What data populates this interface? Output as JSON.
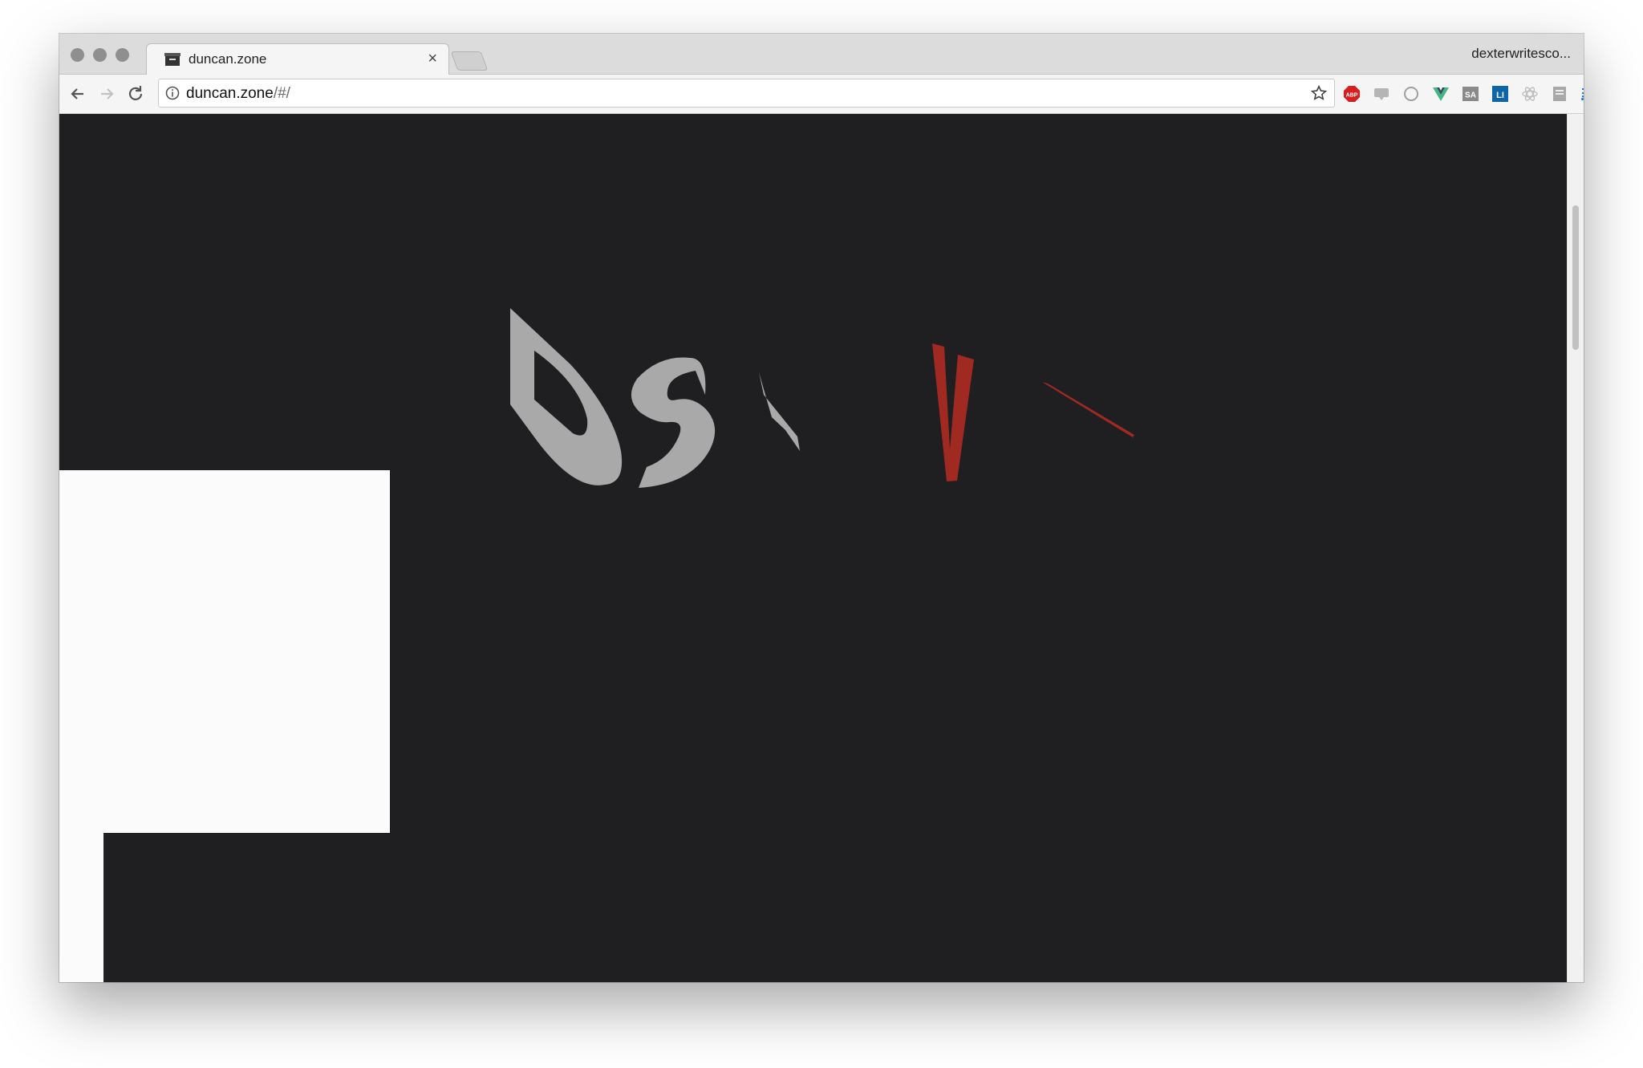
{
  "browser": {
    "tab": {
      "title": "duncan.zone"
    },
    "profile_name": "dexterwritesco...",
    "address": {
      "host": "duncan.zone",
      "path": "/#/"
    },
    "extensions": [
      {
        "name": "adblock-plus",
        "label": "ABP",
        "color": "#d81f1f"
      },
      {
        "name": "chat-extension",
        "label": "",
        "color": "#9e9e9e"
      },
      {
        "name": "circle-extension",
        "label": "",
        "color": "#9e9e9e"
      },
      {
        "name": "vue-devtools",
        "label": "V",
        "color": "#41b883"
      },
      {
        "name": "sa-extension",
        "label": "SA",
        "color": "#8a8a8a"
      },
      {
        "name": "li-extension",
        "label": "LI",
        "color": "#0a66a8"
      },
      {
        "name": "react-devtools",
        "label": "",
        "color": "#b8b8b8"
      },
      {
        "name": "reader-extension",
        "label": "",
        "color": "#9e9e9e"
      },
      {
        "name": "cast-icon",
        "label": "",
        "color": "#1a73e8"
      }
    ]
  },
  "page": {
    "background": "#1f1f21",
    "glyph_colors": {
      "grey": "#a9a9a9",
      "red": "#a02a22"
    },
    "letters": [
      "D",
      "S",
      "V"
    ]
  }
}
